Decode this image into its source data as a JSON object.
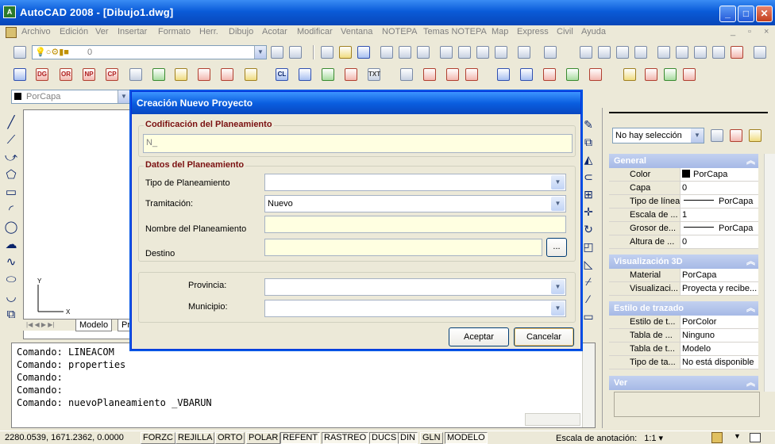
{
  "window": {
    "title": "AutoCAD 2008 - [Dibujo1.dwg]",
    "app_icon": "A",
    "min": "_",
    "max": "□",
    "close": "✕"
  },
  "menu": [
    "Archivo",
    "Edición",
    "Ver",
    "Insertar",
    "Formato",
    "Herr.",
    "Dibujo",
    "Acotar",
    "Modificar",
    "Ventana",
    "NOTEPA",
    "Temas NOTEPA",
    "Map",
    "Express",
    "Civil",
    "Ayuda"
  ],
  "menu_controls": {
    "min": "_",
    "max": "▫",
    "close": "×"
  },
  "layer_combo": "0",
  "bylayer_combo": "PorCapa",
  "toolbar2_labels": [
    "DG",
    "OR",
    "NP",
    "CP",
    "CL",
    "TXT"
  ],
  "ucs": {
    "x": "X",
    "y": "Y"
  },
  "layout_tabs": {
    "model": "Modelo",
    "next": "Pr"
  },
  "command_lines": [
    "Comando: LINEACOM",
    "Comando: properties",
    "Comando:",
    "Comando:",
    "Comando: nuevoPlaneamiento _VBARUN"
  ],
  "status": {
    "coords": "2280.0539, 1671.2362, 0.0000",
    "buttons": [
      "FORZC",
      "REJILLA",
      "ORTO",
      "POLAR",
      "REFENT",
      "RASTREO",
      "DUCS",
      "DIN",
      "GLN",
      "MODELO"
    ],
    "annotation_scale_label": "Escala de anotación:",
    "annotation_scale": "1:1"
  },
  "properties": {
    "selection": "No hay selección",
    "sections": [
      {
        "title": "General",
        "rows": [
          {
            "k": "Color",
            "v": "PorCapa",
            "swatch": "#000000"
          },
          {
            "k": "Capa",
            "v": "0"
          },
          {
            "k": "Tipo de línea",
            "v": "PorCapa",
            "line": true
          },
          {
            "k": "Escala de ...",
            "v": "1"
          },
          {
            "k": "Grosor de...",
            "v": "PorCapa",
            "line": true
          },
          {
            "k": "Altura de ...",
            "v": "0"
          }
        ]
      },
      {
        "title": "Visualización 3D",
        "rows": [
          {
            "k": "Material",
            "v": "PorCapa"
          },
          {
            "k": "Visualizaci...",
            "v": "Proyecta y recibe..."
          }
        ]
      },
      {
        "title": "Estilo de trazado",
        "rows": [
          {
            "k": "Estilo de t...",
            "v": "PorColor"
          },
          {
            "k": "Tabla de ...",
            "v": "Ninguno"
          },
          {
            "k": "Tabla de t...",
            "v": "Modelo"
          },
          {
            "k": "Tipo de ta...",
            "v": "No está disponible"
          }
        ]
      },
      {
        "title": "Ver",
        "rows": []
      }
    ]
  },
  "dialog": {
    "title": "Creación Nuevo Proyecto",
    "group1": {
      "label": "Codificación del Planeamiento",
      "code_value": "N_"
    },
    "group2": {
      "label": "Datos del Planeamiento",
      "tipo_label": "Tipo de Planeamiento",
      "tipo_value": "",
      "tramitacion_label": "Tramitación:",
      "tramitacion_value": "Nuevo",
      "nombre_label": "Nombre del Planeamiento",
      "nombre_value": "",
      "destino_label": "Destino",
      "destino_value": "",
      "browse_label": "..."
    },
    "group3": {
      "provincia_label": "Provincia:",
      "provincia_value": "",
      "municipio_label": "Municipio:",
      "municipio_value": ""
    },
    "accept": "Aceptar",
    "cancel": "Cancelar"
  },
  "colors": {
    "titlebar": "#0A5BD8",
    "dialog_label": "#7A1010",
    "field_bg": "#FFFFE1"
  }
}
